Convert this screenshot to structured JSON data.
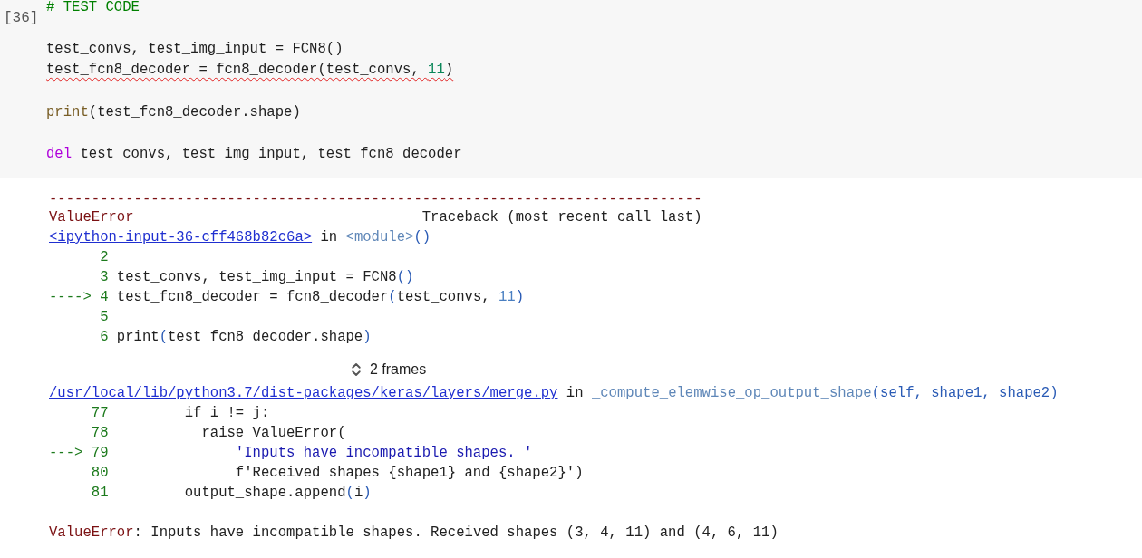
{
  "input_cell": {
    "prompt": "[36]",
    "lines": [
      {
        "kind": "code",
        "tokens": [
          {
            "kind": "comment",
            "text": "# TEST CODE"
          }
        ]
      },
      {
        "kind": "blank"
      },
      {
        "kind": "code",
        "tokens": [
          {
            "kind": "text",
            "text": "test_convs, test_img_input = FCN8()"
          }
        ]
      },
      {
        "kind": "code",
        "warning": true,
        "tokens": [
          {
            "kind": "text",
            "text": "test_fcn8_decoder = fcn8_decoder(test_convs, "
          },
          {
            "kind": "number",
            "text": "11"
          },
          {
            "kind": "text",
            "text": ")"
          }
        ]
      },
      {
        "kind": "blank"
      },
      {
        "kind": "code",
        "tokens": [
          {
            "kind": "builtin",
            "text": "print"
          },
          {
            "kind": "text",
            "text": "(test_fcn8_decoder.shape)"
          }
        ]
      },
      {
        "kind": "blank"
      },
      {
        "kind": "code",
        "tokens": [
          {
            "kind": "keyword",
            "text": "del"
          },
          {
            "kind": "text",
            "text": " test_convs, test_img_input, test_fcn8_decoder"
          }
        ]
      }
    ]
  },
  "output": {
    "rule": "-----------------------------------------------------------------------------",
    "error_type": "ValueError",
    "traceback_title": "Traceback (most recent call last)",
    "frames": [
      {
        "file": "<ipython-input-36-cff468b82c6a>",
        "in": "in",
        "function": "<module>",
        "args": "()",
        "lines": [
          {
            "number": "2"
          },
          {
            "number": "3",
            "tokens": [
              {
                "kind": "text",
                "text": "test_convs, test_img_input = FCN8"
              },
              {
                "kind": "paren",
                "text": "()"
              }
            ]
          },
          {
            "marker": "---->",
            "number": "4",
            "tokens": [
              {
                "kind": "text",
                "text": "test_fcn8_decoder = fcn8_decoder"
              },
              {
                "kind": "paren",
                "text": "("
              },
              {
                "kind": "text",
                "text": "test_convs, "
              },
              {
                "kind": "number",
                "text": "11"
              },
              {
                "kind": "paren",
                "text": ")"
              }
            ]
          },
          {
            "number": "5"
          },
          {
            "number": "6",
            "tokens": [
              {
                "kind": "text",
                "text": "print"
              },
              {
                "kind": "paren",
                "text": "("
              },
              {
                "kind": "text",
                "text": "test_fcn8_decoder.shape"
              },
              {
                "kind": "paren",
                "text": ")"
              }
            ]
          }
        ]
      },
      {
        "file": "/usr/local/lib/python3.7/dist-packages/keras/layers/merge.py",
        "in": "in",
        "function": "_compute_elemwise_op_output_shape",
        "args": "(self, shape1, shape2)",
        "lines": [
          {
            "number": "77",
            "tokens": [
              {
                "kind": "text",
                "text": "        if i != j:"
              }
            ]
          },
          {
            "number": "78",
            "tokens": [
              {
                "kind": "text",
                "text": "          raise ValueError("
              }
            ]
          },
          {
            "marker": "--->",
            "number": "79",
            "tokens": [
              {
                "kind": "string",
                "text": "              'Inputs have incompatible shapes. '"
              }
            ]
          },
          {
            "number": "80",
            "tokens": [
              {
                "kind": "text",
                "text": "              f'Received shapes {shape1} and {shape2}')"
              }
            ]
          },
          {
            "number": "81",
            "tokens": [
              {
                "kind": "text",
                "text": "        output_shape.append"
              },
              {
                "kind": "paren",
                "text": "("
              },
              {
                "kind": "text",
                "text": "i"
              },
              {
                "kind": "paren",
                "text": ")"
              }
            ]
          }
        ]
      }
    ],
    "collapsed": {
      "label": "2 frames",
      "expanded": false
    },
    "final_error": {
      "type": "ValueError",
      "message": ": Inputs have incompatible shapes. Received shapes (3, 4, 11) and (4, 6, 11)"
    }
  }
}
